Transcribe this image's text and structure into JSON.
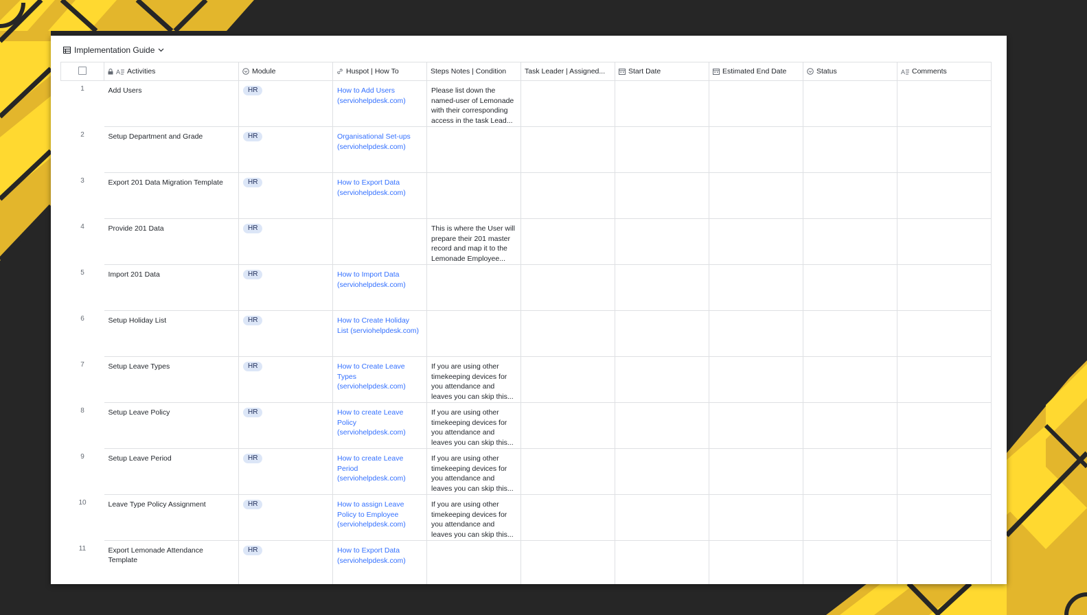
{
  "colors": {
    "accent": "#FFD930",
    "accent_dark": "#E3B62C",
    "background": "#262626",
    "link": "#3370FF",
    "tag_bg": "#DCE6F7"
  },
  "view": {
    "title": "Implementation Guide",
    "icon": "table-icon",
    "dropdown_icon": "chevron-down-icon"
  },
  "columns": [
    {
      "label": "Activities",
      "icon": "text-field-icon",
      "locked": true
    },
    {
      "label": "Module",
      "icon": "single-select-icon"
    },
    {
      "label": "Huspot | How To",
      "icon": "link-icon"
    },
    {
      "label": "Steps Notes | Condition",
      "icon": ""
    },
    {
      "label": "Task Leader | Assigned...",
      "icon": ""
    },
    {
      "label": "Start Date",
      "icon": "calendar-icon"
    },
    {
      "label": "Estimated End Date",
      "icon": "calendar-icon"
    },
    {
      "label": "Status",
      "icon": "single-select-icon"
    },
    {
      "label": "Comments",
      "icon": "text-field-icon"
    }
  ],
  "rows": [
    {
      "num": "1",
      "activity": "Add Users",
      "module": "HR",
      "link": "How to Add Users (serviohelpdesk.com)",
      "notes": "Please list down the named-user of Lemonade with their corresponding access in the task Lead..."
    },
    {
      "num": "2",
      "activity": "Setup Department and Grade",
      "module": "HR",
      "link": "Organisational Set-ups (serviohelpdesk.com)",
      "notes": ""
    },
    {
      "num": "3",
      "activity": "Export 201 Data Migration Template",
      "module": "HR",
      "link": "How to Export Data (serviohelpdesk.com)",
      "notes": ""
    },
    {
      "num": "4",
      "activity": "Provide 201 Data",
      "module": "HR",
      "link": "",
      "notes": "This is where the User will prepare their 201 master record and map it to the Lemonade Employee..."
    },
    {
      "num": "5",
      "activity": "Import 201 Data",
      "module": "HR",
      "link": "How to Import Data (serviohelpdesk.com)",
      "notes": ""
    },
    {
      "num": "6",
      "activity": "Setup Holiday List",
      "module": "HR",
      "link": "How to Create Holiday List (serviohelpdesk.com)",
      "notes": ""
    },
    {
      "num": "7",
      "activity": "Setup Leave Types",
      "module": "HR",
      "link": "How to Create Leave Types (serviohelpdesk.com)",
      "notes": "If you are using other timekeeping devices for you attendance and leaves you can skip this..."
    },
    {
      "num": "8",
      "activity": "Setup Leave Policy",
      "module": "HR",
      "link": "How to create Leave Policy (serviohelpdesk.com)",
      "notes": "If you are using other timekeeping devices for you attendance and leaves you can skip this..."
    },
    {
      "num": "9",
      "activity": "Setup Leave Period",
      "module": "HR",
      "link": "How to create Leave Period (serviohelpdesk.com)",
      "notes": "If you are using other timekeeping devices for you attendance and leaves you can skip this..."
    },
    {
      "num": "10",
      "activity": "Leave Type Policy  Assignment",
      "module": "HR",
      "link": "How to assign Leave Policy to Employee (serviohelpdesk.com)",
      "notes": "If you are using other timekeeping devices for you attendance and leaves you can skip this..."
    },
    {
      "num": "11",
      "activity": "Export Lemonade Attendance Template",
      "module": "HR",
      "link": "How to Export Data (serviohelpdesk.com)",
      "notes": ""
    }
  ]
}
